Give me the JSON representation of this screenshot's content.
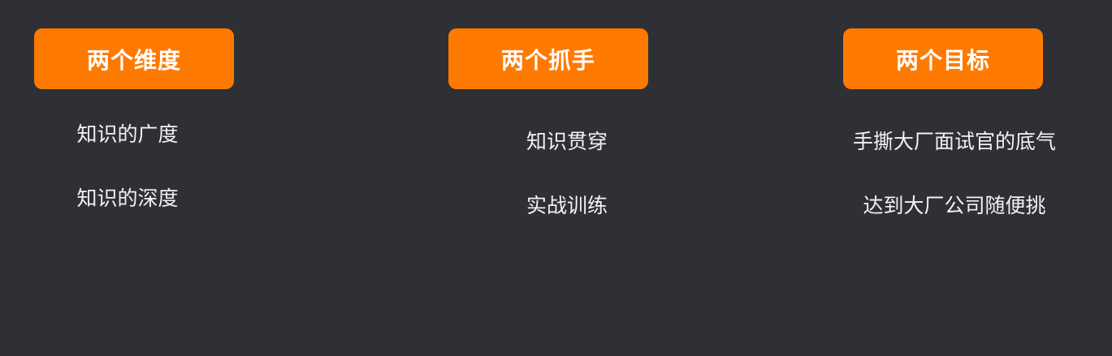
{
  "colors": {
    "background": "#2e3035",
    "accent": "#ff7a00",
    "text": "#f2f2f2"
  },
  "columns": [
    {
      "title": "两个维度",
      "items": [
        "知识的广度",
        "知识的深度"
      ]
    },
    {
      "title": "两个抓手",
      "items": [
        "知识贯穿",
        "实战训练"
      ]
    },
    {
      "title": "两个目标",
      "items": [
        "手撕大厂面试官的底气",
        "达到大厂公司随便挑"
      ]
    }
  ]
}
